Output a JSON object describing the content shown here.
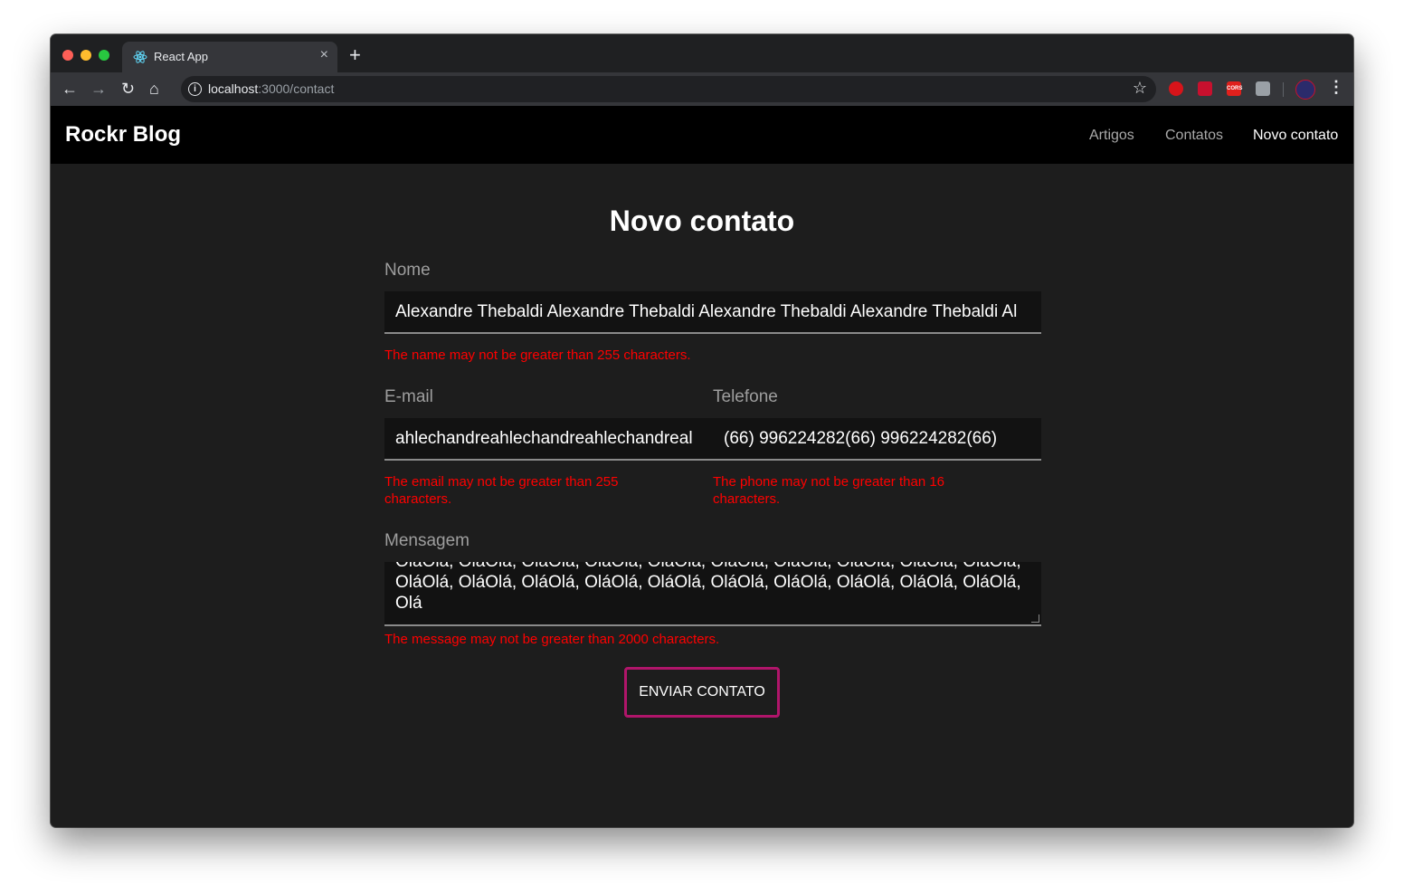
{
  "browser": {
    "tab_title": "React App",
    "tab_close": "×",
    "new_tab": "+",
    "url_host": "localhost",
    "url_path": ":3000/contact",
    "back": "←",
    "forward": "→",
    "reload": "↻",
    "home": "⌂",
    "info": "i",
    "star": "☆",
    "menu": "⋮",
    "ext_label": "CORS"
  },
  "site": {
    "brand": "Rockr Blog",
    "nav": [
      "Artigos",
      "Contatos",
      "Novo contato"
    ],
    "active_nav": "Novo contato"
  },
  "form": {
    "title": "Novo contato",
    "name_label": "Nome",
    "name_value": "Alexandre Thebaldi Alexandre Thebaldi Alexandre Thebaldi Alexandre Thebaldi Al",
    "name_error": "The name may not be greater than 255 characters.",
    "email_label": "E-mail",
    "email_value": "ahlechandreahlechandreahlechandreal",
    "email_error": "The email may not be greater than 255 characters.",
    "phone_label": "Telefone",
    "phone_value": "(66) 996224282(66) 996224282(66)",
    "phone_error": "The phone may not be greater than 16 characters.",
    "message_label": "Mensagem",
    "message_value": "OláOlá, OláOlá, OláOlá, OláOlá, OláOlá, OláOlá, OláOlá, OláOlá, OláOlá, OláOlá, OláOlá, OláOlá, OláOlá, OláOlá, OláOlá, OláOlá, OláOlá, OláOlá, OláOlá, OláOlá, Olá",
    "message_error": "The message may not be greater than 2000 characters.",
    "submit_label": "ENVIAR CONTATO"
  },
  "colors": {
    "accent": "#b0156a",
    "error": "#ff0000",
    "background": "#1d1d1d"
  }
}
